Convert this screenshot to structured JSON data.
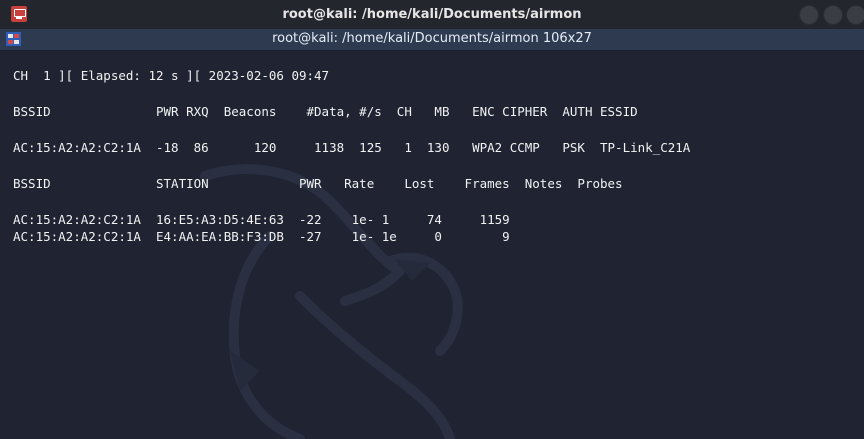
{
  "window": {
    "title": "root@kali: /home/kali/Documents/airmon"
  },
  "tab": {
    "title": "root@kali: /home/kali/Documents/airmon 106x27"
  },
  "terminal": {
    "lines": {
      "status": "CH  1 ][ Elapsed: 12 s ][ 2023-02-06 09:47",
      "ap_header": "BSSID              PWR RXQ  Beacons    #Data, #/s  CH   MB   ENC CIPHER  AUTH ESSID",
      "ap_row_1": "AC:15:A2:A2:C2:1A  -18  86      120     1138  125   1  130   WPA2 CCMP   PSK  TP-Link_C21A",
      "station_header": "BSSID              STATION            PWR   Rate    Lost    Frames  Notes  Probes",
      "station_row_1": "AC:15:A2:A2:C2:1A  16:E5:A3:D5:4E:63  -22    1e- 1     74     1159",
      "station_row_2": "AC:15:A2:A2:C2:1A  E4:AA:EA:BB:F3:DB  -27    1e- 1e     0        9"
    }
  },
  "icons": {
    "app": "terminal-app-icon",
    "tab": "terminal-tab-icon",
    "minimize": "minimize-icon",
    "maximize": "maximize-icon",
    "close": "close-icon",
    "background": "kali-dragon-icon"
  },
  "colors": {
    "terminal_bg": "#1f2332",
    "text": "#f2f2f2",
    "titlebar_bg": "#23262d",
    "tabbar_bg": "#2d3a50"
  }
}
